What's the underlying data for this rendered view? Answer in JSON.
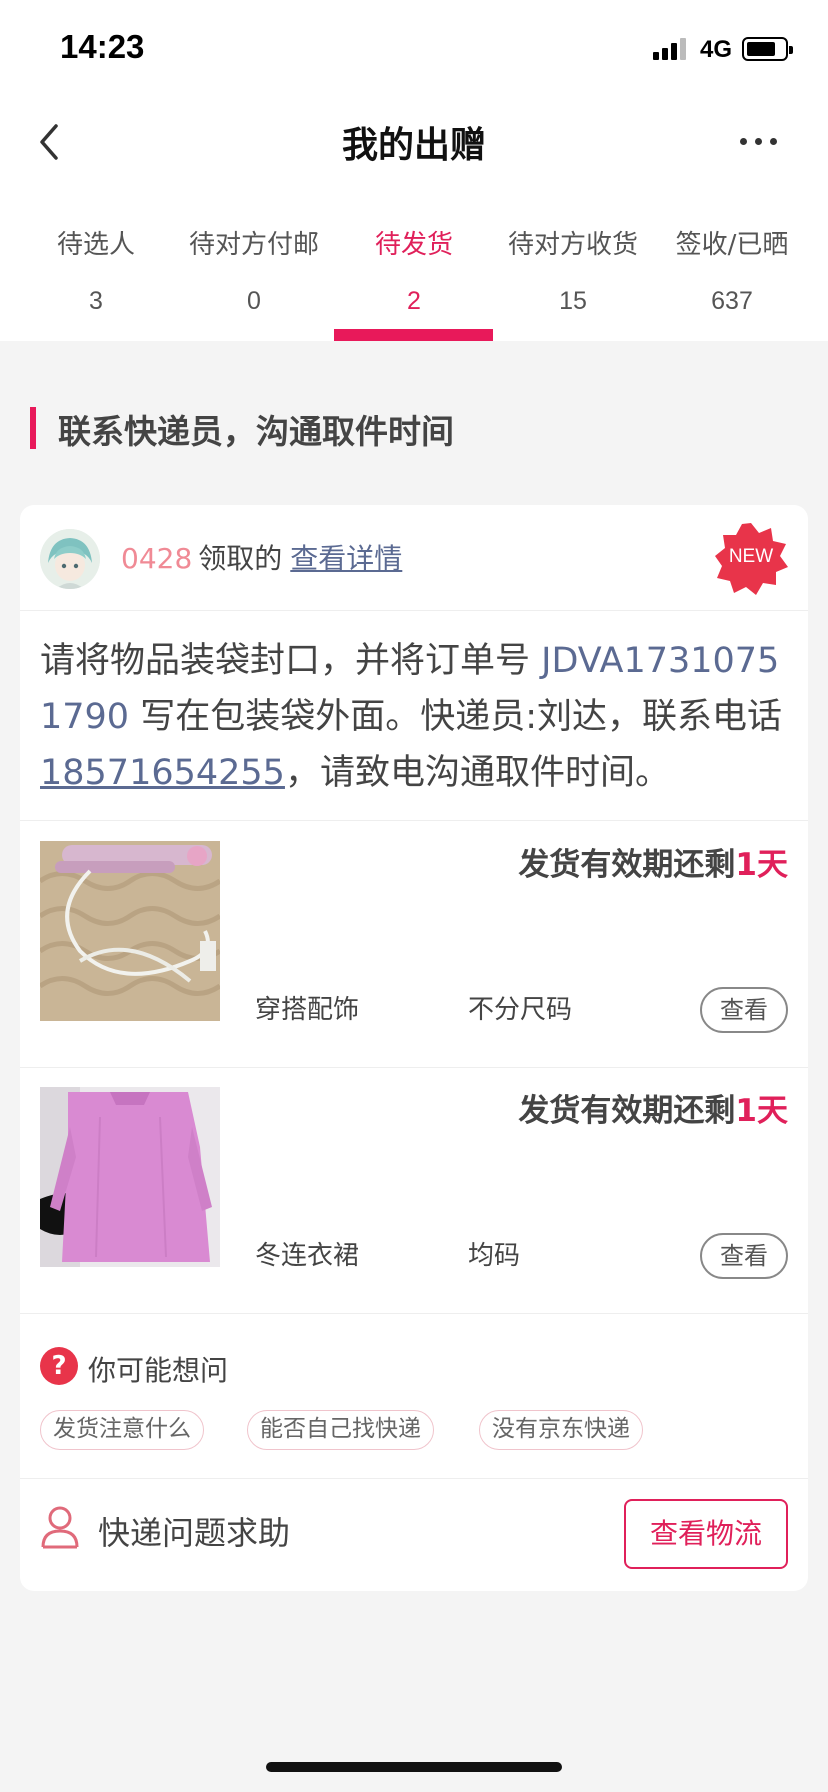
{
  "status_bar": {
    "time": "14:23",
    "network": "4G"
  },
  "nav": {
    "title": "我的出赠"
  },
  "tabs": [
    {
      "label": "待选人",
      "count": "3"
    },
    {
      "label": "待对方付邮",
      "count": "0"
    },
    {
      "label": "待发货",
      "count": "2",
      "active": true
    },
    {
      "label": "待对方收货",
      "count": "15"
    },
    {
      "label": "签收/已晒",
      "count": "637"
    }
  ],
  "section": {
    "title": "联系快递员，沟通取件时间"
  },
  "card": {
    "user_id": "0428",
    "claim_text": "领取的",
    "detail_link": "查看详情",
    "badge": "NEW",
    "instruction": {
      "part1": "请将物品装袋封口，并将订单号 ",
      "order_no": "JDVA17310751790",
      "part2": " 写在包装袋外面。快递员:刘达，联系电话",
      "phone": "18571654255",
      "part3": "，请致电沟通取件时间。"
    },
    "items": [
      {
        "deadline_prefix": "发货有效期还剩",
        "deadline_days": "1天",
        "category": "穿搭配饰",
        "size": "不分尺码",
        "view_label": "查看"
      },
      {
        "deadline_prefix": "发货有效期还剩",
        "deadline_days": "1天",
        "category": "冬连衣裙",
        "size": "均码",
        "view_label": "查看"
      }
    ],
    "faq": {
      "title": "你可能想问",
      "questions": [
        "发货注意什么",
        "能否自己找快递",
        "没有京东快递"
      ]
    },
    "help_label": "快递问题求助",
    "logistics_button": "查看物流"
  },
  "colors": {
    "accent": "#e0205a",
    "link": "#5b6a92",
    "background": "#f4f4f4"
  }
}
